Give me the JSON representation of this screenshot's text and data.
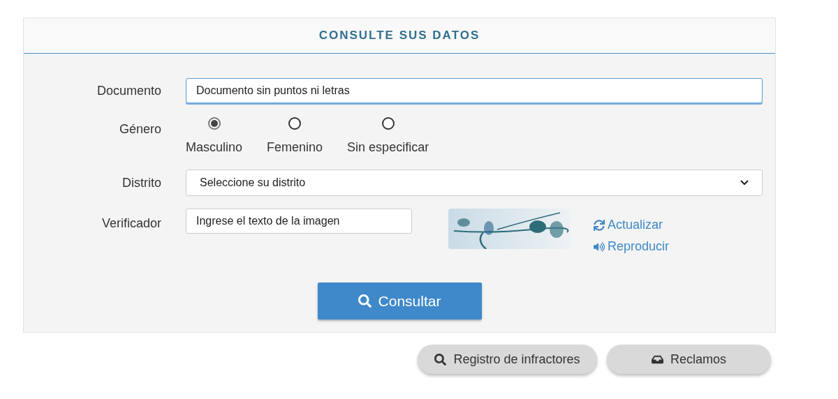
{
  "panel": {
    "title": "CONSULTE SUS DATOS"
  },
  "documento": {
    "label": "Documento",
    "placeholder": "Documento sin puntos ni letras",
    "focused": true
  },
  "genero": {
    "label": "Género",
    "options": [
      {
        "label": "Masculino",
        "selected": true
      },
      {
        "label": "Femenino",
        "selected": false
      },
      {
        "label": "Sin especificar",
        "selected": false
      }
    ]
  },
  "distrito": {
    "label": "Distrito",
    "value": "Seleccione su distrito"
  },
  "verificador": {
    "label": "Verificador",
    "placeholder": "Ingrese el texto de la imagen",
    "links": [
      {
        "kind": "refresh",
        "label": "Actualizar"
      },
      {
        "kind": "audio",
        "label": "Reproducir"
      }
    ]
  },
  "submit": {
    "label": "Consultar"
  },
  "actions": [
    {
      "kind": "search",
      "label": "Registro de infractores"
    },
    {
      "kind": "inbox",
      "label": "Reclamos"
    }
  ]
}
